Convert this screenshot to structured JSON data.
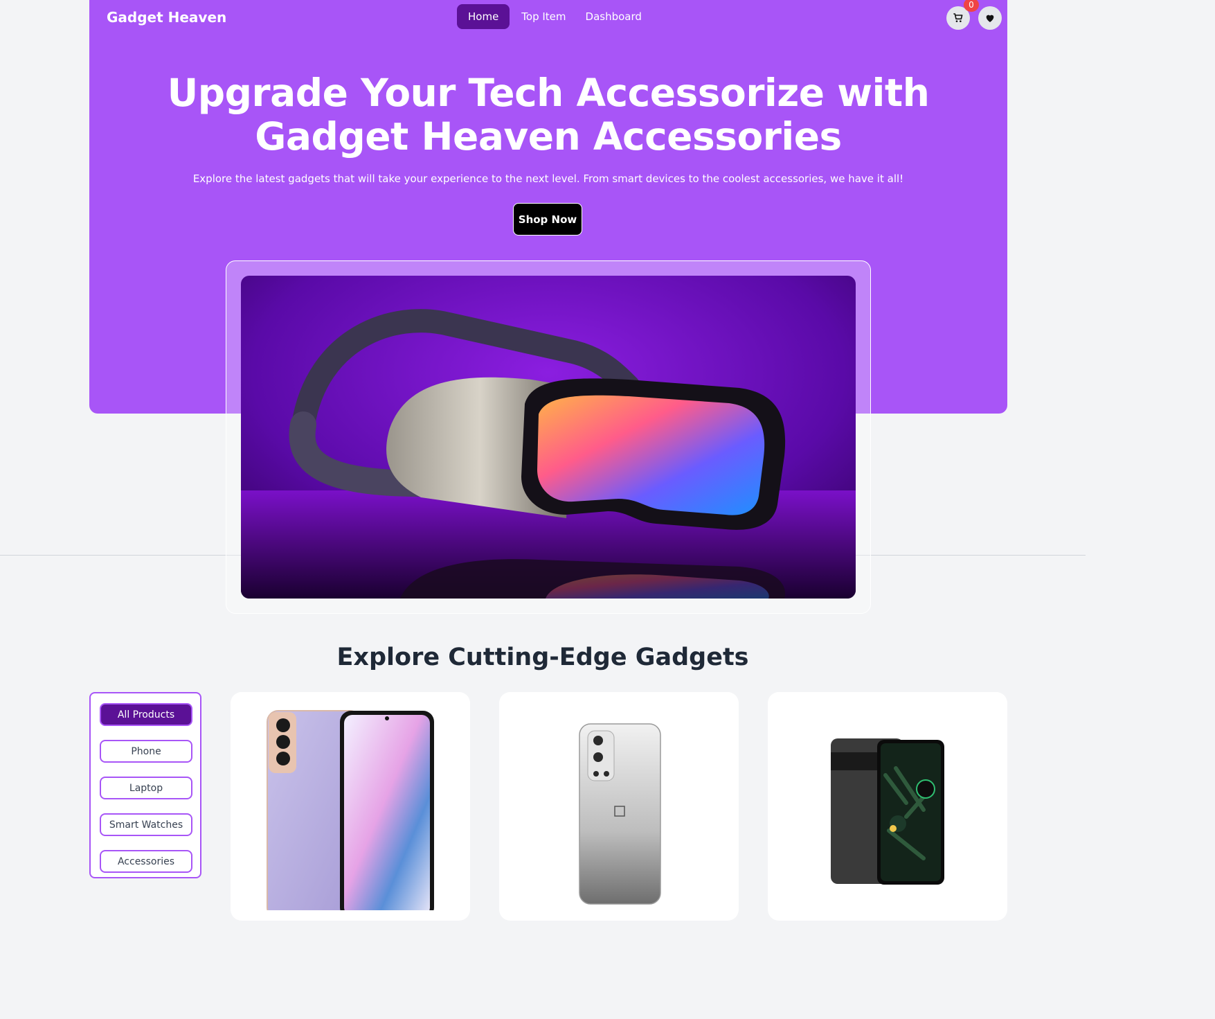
{
  "nav": {
    "brand": "Gadget Heaven",
    "links": [
      "Home",
      "Top Item",
      "Dashboard"
    ],
    "active": "Home",
    "cart_count": "0",
    "icons": [
      "cart-icon",
      "heart-icon"
    ]
  },
  "hero": {
    "title_line1": "Upgrade Your Tech Accessorize with",
    "title_line2": "Gadget Heaven Accessories",
    "subtitle": "Explore the latest gadgets that will take your experience to the next level. From smart devices to the coolest accessories, we have it all!",
    "cta": "Shop Now"
  },
  "products_section": {
    "title": "Explore Cutting-Edge Gadgets",
    "categories": [
      "All Products",
      "Phone",
      "Laptop",
      "Smart Watches",
      "Accessories"
    ],
    "active_category": "All Products",
    "product_images": [
      "purple smartphone front and back",
      "silver smartphone back",
      "black smartphone front and back"
    ]
  },
  "colors": {
    "brand": "#a855f7",
    "active": "#5b1196",
    "background": "#f3f4f6",
    "badge": "#ef4444"
  }
}
